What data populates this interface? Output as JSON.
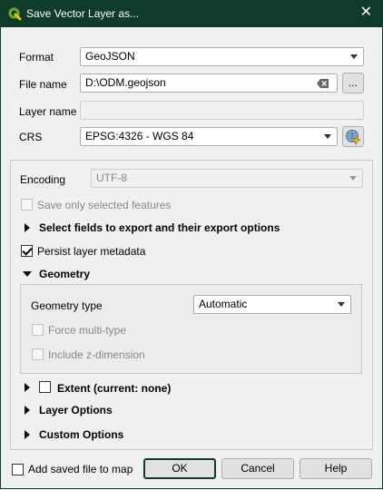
{
  "window": {
    "title": "Save Vector Layer as...",
    "close_glyph": "✕"
  },
  "form": {
    "format_label": "Format",
    "format_value": "GeoJSON",
    "filename_label": "File name",
    "filename_value": "D:\\ODM.geojson",
    "browse_label": "...",
    "layername_label": "Layer name",
    "layername_value": "",
    "crs_label": "CRS",
    "crs_value": "EPSG:4326 - WGS 84"
  },
  "options": {
    "encoding_label": "Encoding",
    "encoding_value": "UTF-8",
    "save_selected_label": "Save only selected features",
    "select_fields_label": "Select fields to export and their export options",
    "persist_metadata_label": "Persist layer metadata",
    "persist_metadata_checked": true,
    "geometry_label": "Geometry",
    "geometry_type_label": "Geometry type",
    "geometry_type_value": "Automatic",
    "force_multi_label": "Force multi-type",
    "include_z_label": "Include z-dimension",
    "extent_label": "Extent (current: none)",
    "layer_options_label": "Layer Options",
    "custom_options_label": "Custom Options"
  },
  "footer": {
    "add_saved_label": "Add saved file to map",
    "ok_label": "OK",
    "cancel_label": "Cancel",
    "help_label": "Help"
  },
  "icons": {
    "app": "qgis-icon",
    "crs_select": "crs-globe-icon",
    "clear": "clear-input-icon"
  },
  "colors": {
    "titlebar": "#0f3b2a",
    "qgis_green": "#8bc34a",
    "qgis_yellow": "#f5c400"
  }
}
